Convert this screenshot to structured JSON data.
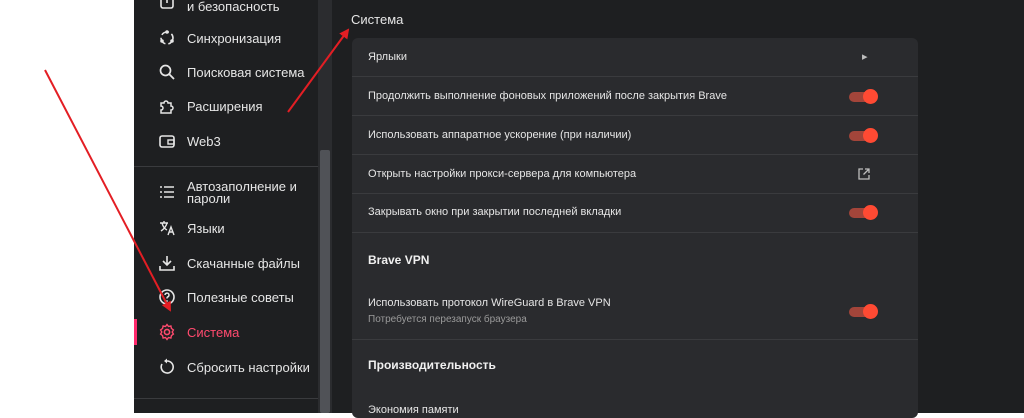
{
  "sidebar": {
    "items": [
      {
        "label": "и безопасность",
        "icon": "lock-icon"
      },
      {
        "label": "Синхронизация",
        "icon": "sync-icon"
      },
      {
        "label": "Поисковая система",
        "icon": "search-icon"
      },
      {
        "label": "Расширения",
        "icon": "puzzle-icon"
      },
      {
        "label": "Web3",
        "icon": "wallet-icon"
      },
      {
        "label_line1": "Автозаполнение и",
        "label_line2": "пароли",
        "icon": "autofill-list-icon"
      },
      {
        "label": "Языки",
        "icon": "translate-icon"
      },
      {
        "label": "Скачанные файлы",
        "icon": "download-icon"
      },
      {
        "label": "Полезные советы",
        "icon": "help-icon"
      },
      {
        "label": "Система",
        "icon": "gear-icon",
        "active": true
      },
      {
        "label": "Сбросить настройки",
        "icon": "reset-icon"
      }
    ]
  },
  "main": {
    "section_title": "Система",
    "rows": {
      "shortcuts": "Ярлыки",
      "background_apps": "Продолжить выполнение фоновых приложений после закрытия Brave",
      "hw_accel": "Использовать аппаратное ускорение (при наличии)",
      "proxy": "Открыть настройки прокси-сервера для компьютера",
      "close_window": "Закрывать окно при закрытии последней вкладки",
      "vpn_heading": "Brave VPN",
      "wireguard": "Использовать протокол WireGuard в Brave VPN",
      "wireguard_sub": "Потребуется перезапуск браузера",
      "perf_heading": "Производительность",
      "memory_saver": "Экономия памяти"
    },
    "toggles": {
      "background_apps": "on",
      "hw_accel": "on",
      "close_window": "on",
      "wireguard": "on"
    }
  },
  "colors": {
    "accent": "#ff4a33",
    "active_nav": "#ff4a6e",
    "annotation_arrow": "#e31e24"
  }
}
